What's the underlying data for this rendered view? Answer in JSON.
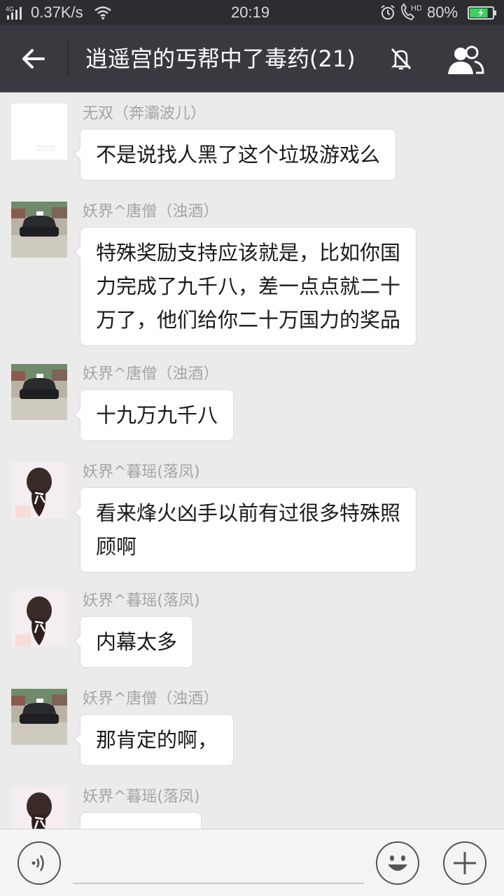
{
  "status_bar": {
    "network": "4G",
    "speed": "0.37K/s",
    "time": "20:19",
    "call_badge": "HD",
    "battery_percent": "80%",
    "battery_level": 0.8
  },
  "header": {
    "title": "逍遥宫的丐帮中了毒药(21)",
    "icons": [
      "back-arrow-icon",
      "mute-icon",
      "group-members-icon"
    ]
  },
  "colors": {
    "status_bar_bg": "#2b2d30",
    "title_bar_bg": "#393a3f",
    "chat_bg": "#ebebeb",
    "bubble_bg": "#ffffff",
    "battery_fill": "#3ad15c"
  },
  "messages": [
    {
      "sender": "无双（奔灞波儿）",
      "text": "不是说找人黑了这个垃圾游戏么",
      "avatar": "white",
      "avatar_text": "♡♡♡"
    },
    {
      "sender": "妖界^唐僧（浊酒）",
      "text": "特殊奖励支持应该就是，比如你国\n力完成了九千八，差一点点就二十\n万了，他们给你二十万国力的奖品",
      "avatar": "car"
    },
    {
      "sender": "妖界^唐僧（浊酒）",
      "text": "十九万九千八",
      "avatar": "car"
    },
    {
      "sender": "妖界^暮瑶(落凤)",
      "text": "看来烽火凶手以前有过很多特殊照\n顾啊",
      "avatar": "girl"
    },
    {
      "sender": "妖界^暮瑶(落凤)",
      "text": "内幕太多",
      "avatar": "girl"
    },
    {
      "sender": "妖界^唐僧（浊酒）",
      "text": "那肯定的啊，",
      "avatar": "car"
    },
    {
      "sender": "妖界^暮瑶(落凤)",
      "text": "",
      "avatar": "girl"
    }
  ],
  "input": {
    "icons": [
      "voice-icon",
      "emoji-icon",
      "plus-icon"
    ]
  }
}
